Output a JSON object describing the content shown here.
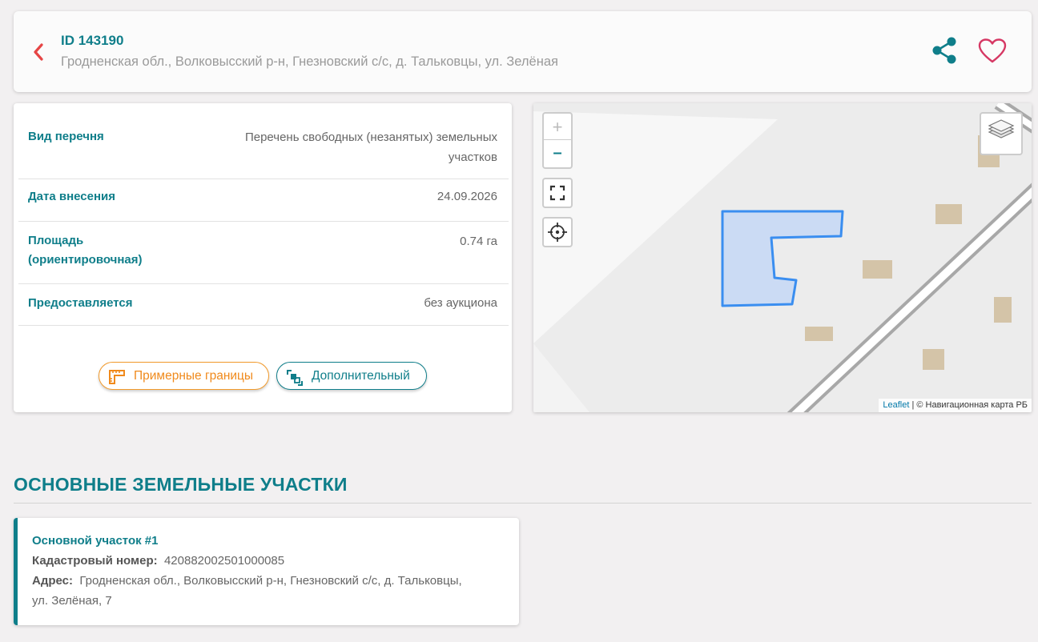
{
  "header": {
    "id": "ID 143190",
    "address": "Гродненская обл., Волковысский р-н, Гнезновский с/с, д. Тальковцы, ул. Зелёная"
  },
  "info": {
    "rows": [
      {
        "label": "Вид перечня",
        "value_line1": "Перечень свободных (незанятых) земельных",
        "value_line2": "участков"
      },
      {
        "label": "Дата внесения",
        "value": "24.09.2026"
      },
      {
        "label_line1": "Площадь",
        "label_line2": "(ориентировочная)",
        "value": "0.74 га"
      },
      {
        "label": "Предоставляется",
        "value": "без аукциона"
      }
    ],
    "bounds_button": "Примерные границы",
    "extra_button": "Дополнительный"
  },
  "map": {
    "zoom_in": "+",
    "zoom_out": "–",
    "attribution_link": "Leaflet",
    "attribution_text": " | © Навигационная карта РБ"
  },
  "section": {
    "title": "ОСНОВНЫЕ ЗЕМЕЛЬНЫЕ УЧАСТКИ"
  },
  "plot": {
    "title": "Основной участок #1",
    "cadastral_label": "Кадастровый номер:",
    "cadastral_value": "420882002501000085",
    "address_label": "Адрес:",
    "address_line1": "Гродненская обл., Волковысский р-н, Гнезновский с/с, д. Тальковцы,",
    "address_line2": "ул. Зелёная, 7"
  },
  "colors": {
    "accent": "#0f7e8a",
    "back": "#e64545",
    "favorite": "#d63864",
    "orange": "#f08a1c",
    "parcel_fill": "#c9daf4",
    "parcel_stroke": "#3a8ef0"
  }
}
